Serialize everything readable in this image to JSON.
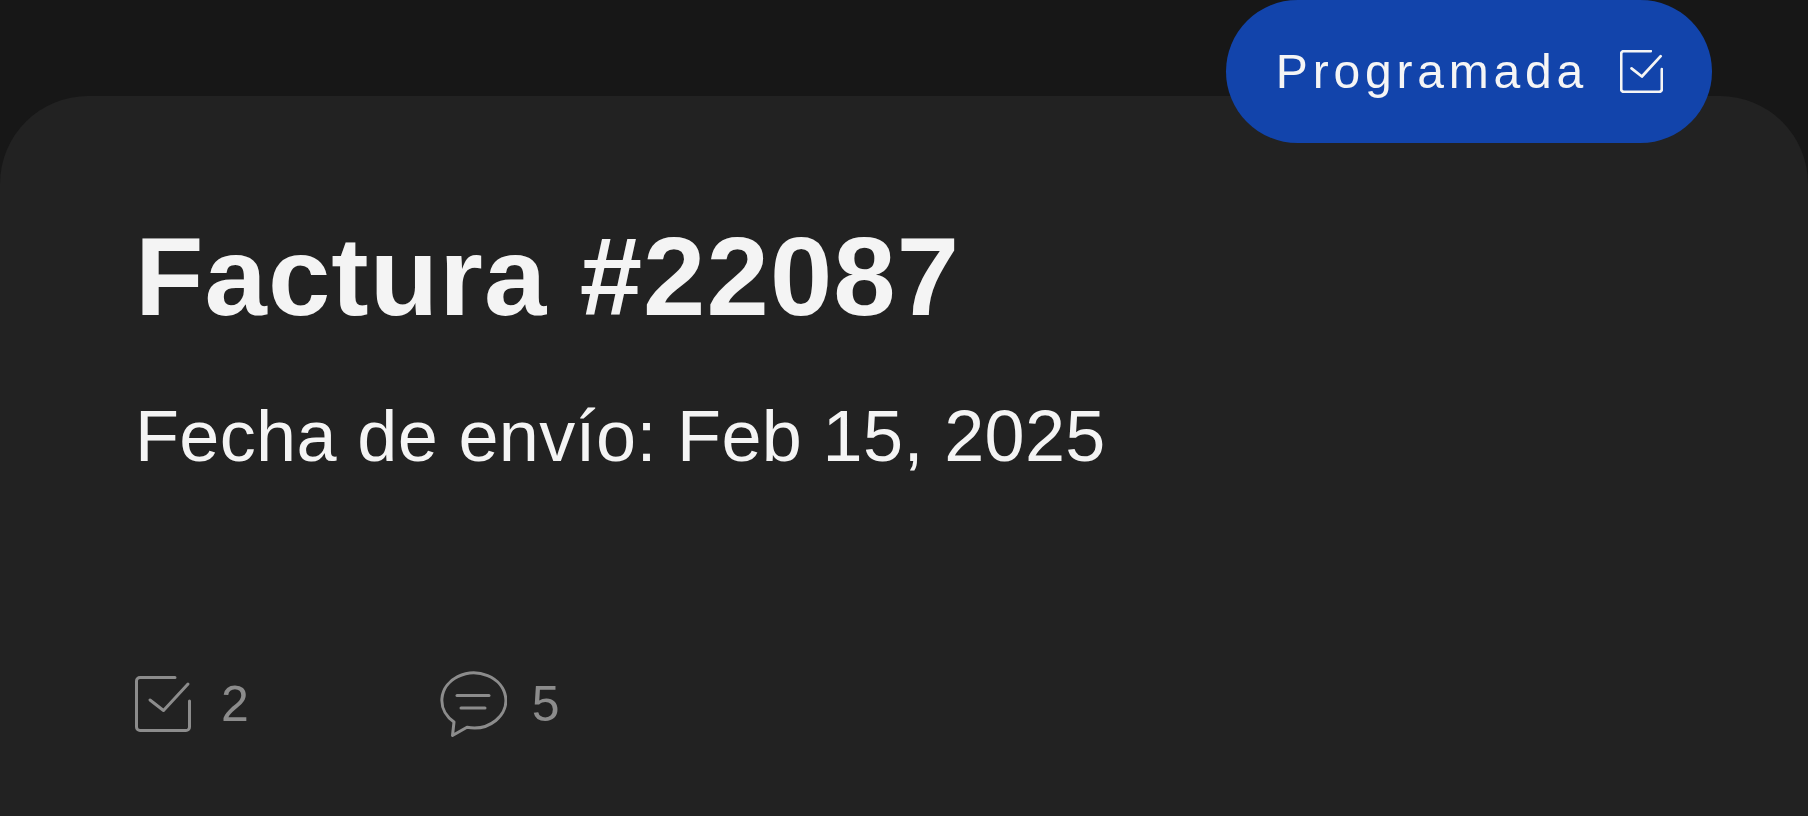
{
  "status_badge": {
    "label": "Programada"
  },
  "title": "Factura #22087",
  "subtitle": "Fecha de envío: Feb 15, 2025",
  "counters": [
    {
      "kind": "tasks",
      "count": "2"
    },
    {
      "kind": "comments",
      "count": "5"
    }
  ]
}
